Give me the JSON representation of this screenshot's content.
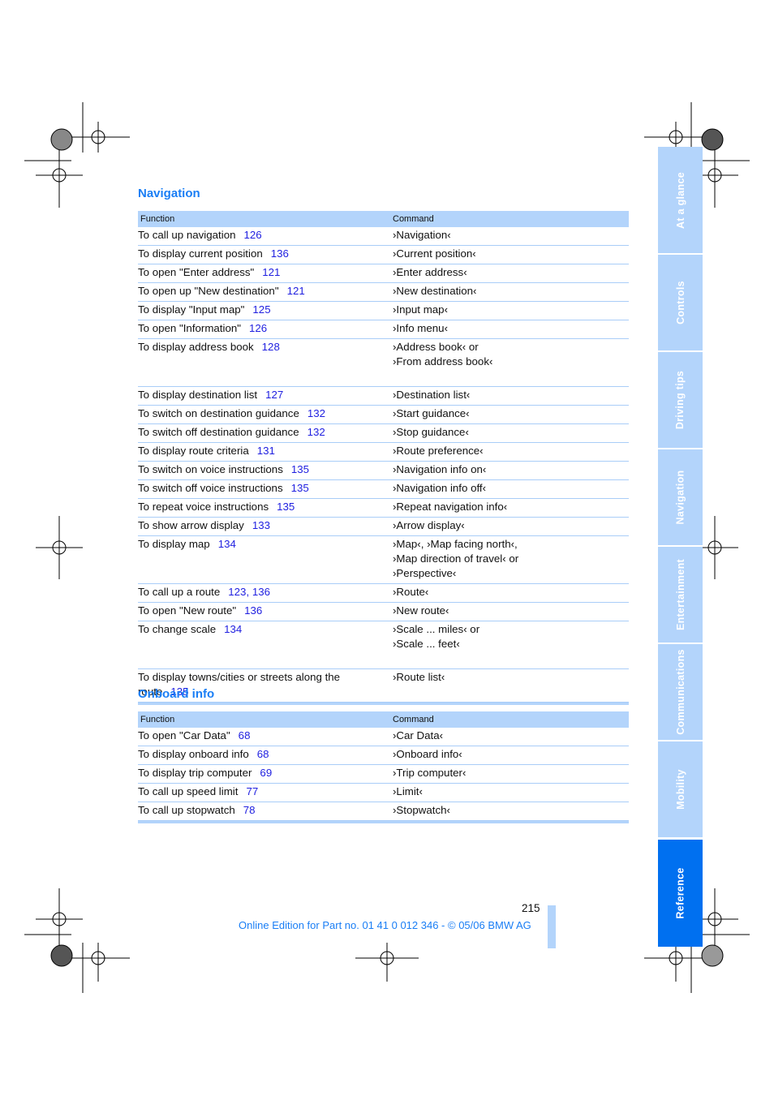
{
  "sections": [
    {
      "title": "Navigation",
      "header": {
        "function": "Function",
        "command": "Command"
      },
      "rows": [
        {
          "function": "To call up navigation",
          "page": "126",
          "command": [
            "›Navigation‹"
          ]
        },
        {
          "function": "To display current position",
          "page": "136",
          "command": [
            "›Current position‹"
          ]
        },
        {
          "function": "To open \"Enter address\"",
          "page": "121",
          "command": [
            "›Enter address‹"
          ]
        },
        {
          "function": "To open up \"New destination\"",
          "page": "121",
          "command": [
            "›New destination‹"
          ]
        },
        {
          "function": "To display \"Input map\"",
          "page": "125",
          "command": [
            "›Input map‹"
          ]
        },
        {
          "function": "To open \"Information\"",
          "page": "126",
          "command": [
            "›Info menu‹"
          ]
        },
        {
          "function": "To display address book",
          "page": "128",
          "command": [
            "›Address book‹ or",
            "›From address book‹",
            ""
          ]
        },
        {
          "function": "To display destination list",
          "page": "127",
          "command": [
            "›Destination list‹"
          ]
        },
        {
          "function": "To switch on destination guidance",
          "page": "132",
          "command": [
            "›Start guidance‹"
          ]
        },
        {
          "function": "To switch off destination guidance",
          "page": "132",
          "command": [
            "›Stop guidance‹"
          ]
        },
        {
          "function": "To display route criteria",
          "page": "131",
          "command": [
            "›Route preference‹"
          ]
        },
        {
          "function": "To switch on voice instructions",
          "page": "135",
          "command": [
            "›Navigation info on‹"
          ]
        },
        {
          "function": "To switch off voice instructions",
          "page": "135",
          "command": [
            "›Navigation info off‹"
          ]
        },
        {
          "function": "To repeat voice instructions",
          "page": "135",
          "command": [
            "›Repeat navigation info‹"
          ]
        },
        {
          "function": "To show arrow display",
          "page": "133",
          "command": [
            "›Arrow display‹"
          ]
        },
        {
          "function": "To display map",
          "page": "134",
          "command": [
            "›Map‹, ›Map facing north‹,",
            "›Map direction of travel‹ or",
            "›Perspective‹"
          ]
        },
        {
          "function": "To call up a route",
          "page": "123, 136",
          "command": [
            "›Route‹"
          ]
        },
        {
          "function": "To open \"New route\"",
          "page": "136",
          "command": [
            "›New route‹"
          ]
        },
        {
          "function": "To change scale",
          "page": "134",
          "command": [
            "›Scale ... miles‹ or",
            "›Scale ... feet‹",
            ""
          ]
        },
        {
          "function": "To display towns/cities or streets along the route",
          "page": "135",
          "command": [
            "›Route list‹"
          ]
        }
      ]
    },
    {
      "title": "Onboard info",
      "header": {
        "function": "Function",
        "command": "Command"
      },
      "rows": [
        {
          "function": "To open \"Car Data\"",
          "page": "68",
          "command": [
            "›Car Data‹"
          ]
        },
        {
          "function": "To display onboard info",
          "page": "68",
          "command": [
            "›Onboard info‹"
          ]
        },
        {
          "function": "To display trip computer",
          "page": "69",
          "command": [
            "›Trip computer‹"
          ]
        },
        {
          "function": "To call up speed limit",
          "page": "77",
          "command": [
            "›Limit‹"
          ]
        },
        {
          "function": "To call up stopwatch",
          "page": "78",
          "command": [
            "›Stopwatch‹"
          ]
        }
      ]
    }
  ],
  "sidebar": {
    "items": [
      {
        "label": "At a glance",
        "active": false
      },
      {
        "label": "Controls",
        "active": false
      },
      {
        "label": "Driving tips",
        "active": false
      },
      {
        "label": "Navigation",
        "active": false
      },
      {
        "label": "Entertainment",
        "active": false
      },
      {
        "label": "Communications",
        "active": false
      },
      {
        "label": "Mobility",
        "active": false
      },
      {
        "label": "Reference",
        "active": true
      }
    ]
  },
  "page_number": "215",
  "footer": "Online Edition for Part no. 01 41 0 012 346 - © 05/06 BMW AG",
  "colors": {
    "accent": "#1a7ef5",
    "table_header": "#b3d4fb",
    "active_tab": "#0070f0",
    "page_ref": "#1f1fe0"
  }
}
